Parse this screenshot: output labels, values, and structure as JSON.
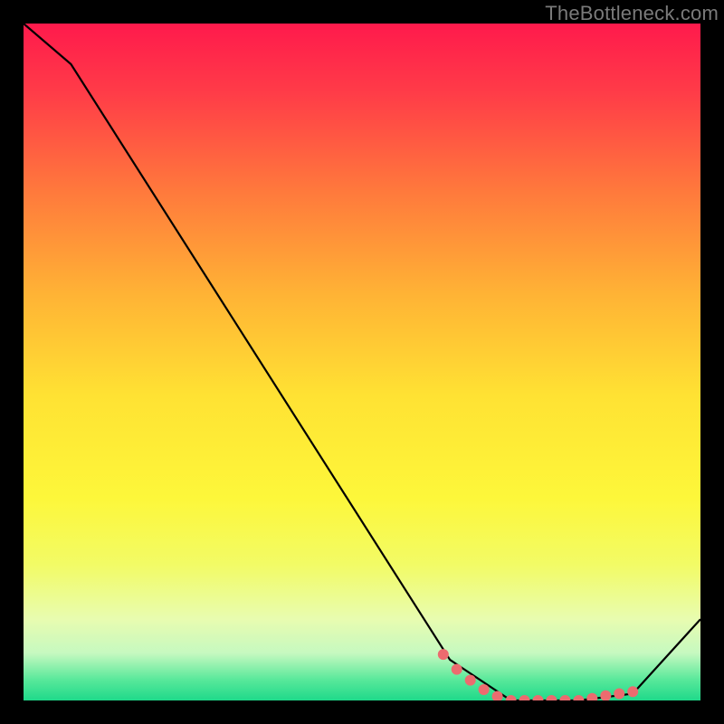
{
  "watermark": "TheBottleneck.com",
  "chart_data": {
    "type": "line",
    "title": "",
    "xlabel": "",
    "ylabel": "",
    "xlim": [
      0,
      100
    ],
    "ylim": [
      0,
      100
    ],
    "curve": {
      "x": [
        0,
        7,
        63,
        72,
        82,
        90,
        100
      ],
      "y": [
        100,
        94,
        6,
        0,
        0,
        1,
        12
      ]
    },
    "markers": {
      "x": [
        62,
        64,
        66,
        68,
        70,
        72,
        74,
        76,
        78,
        80,
        82,
        84,
        86,
        88,
        90
      ],
      "y": [
        6.8,
        4.6,
        3.0,
        1.6,
        0.6,
        0,
        0,
        0,
        0,
        0,
        0,
        0.3,
        0.7,
        1.0,
        1.3
      ],
      "color": "#ec6b6f",
      "size": 6
    },
    "gradient_stops": [
      {
        "offset": 0.0,
        "color": "#ff1a4c"
      },
      {
        "offset": 0.1,
        "color": "#ff3b48"
      },
      {
        "offset": 0.25,
        "color": "#ff7a3c"
      },
      {
        "offset": 0.4,
        "color": "#ffb335"
      },
      {
        "offset": 0.55,
        "color": "#ffe233"
      },
      {
        "offset": 0.7,
        "color": "#fdf73a"
      },
      {
        "offset": 0.8,
        "color": "#f2fb66"
      },
      {
        "offset": 0.88,
        "color": "#e8fcb0"
      },
      {
        "offset": 0.93,
        "color": "#c6f9c0"
      },
      {
        "offset": 0.97,
        "color": "#57e89a"
      },
      {
        "offset": 1.0,
        "color": "#1fd98a"
      }
    ]
  }
}
